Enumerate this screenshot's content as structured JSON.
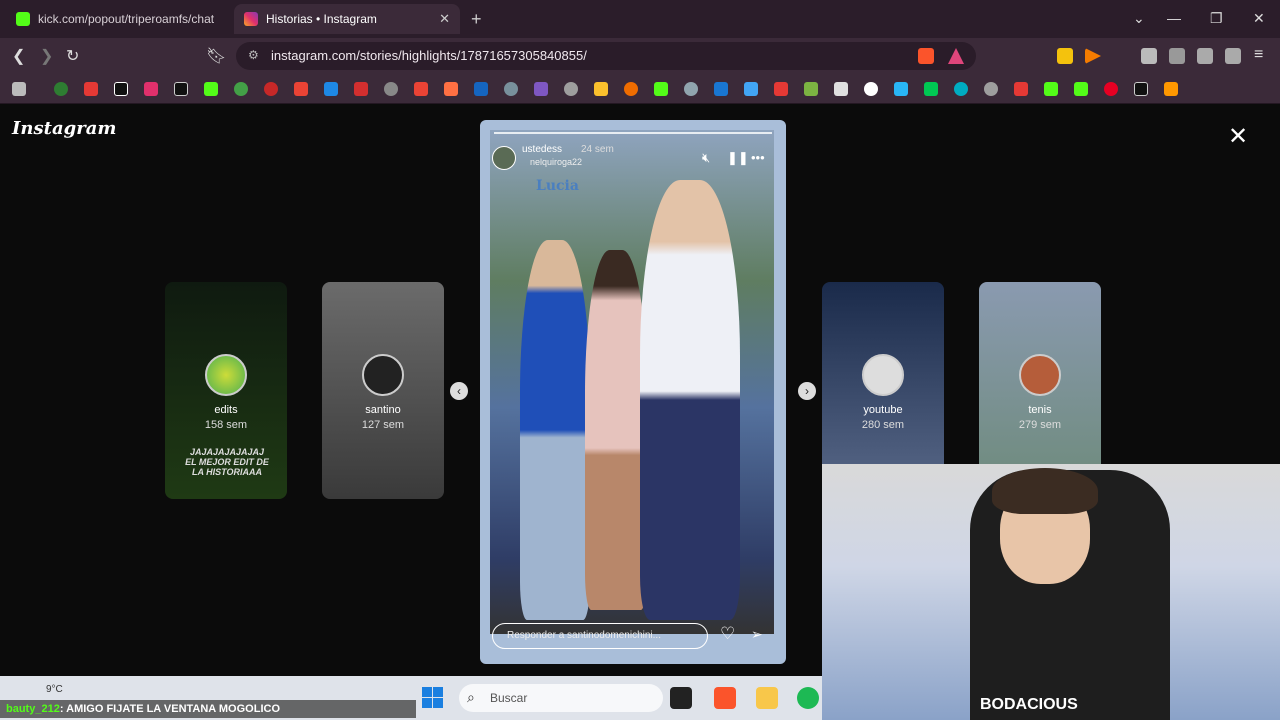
{
  "browser": {
    "tabs": [
      {
        "title": "kick.com/popout/triperoamfs/chat",
        "icon": "kick-icon",
        "color": "#53fc18"
      },
      {
        "title": "Historias • Instagram",
        "icon": "instagram-icon",
        "color": "#e1306c"
      }
    ],
    "url": "instagram.com/stories/highlights/17871657305840855/"
  },
  "instagram": {
    "logo": "Instagram",
    "highlights_left": [
      {
        "name": "edits",
        "age": "158 sem",
        "caption": "JAJAJAJAJAJAJ EL MEJOR EDIT DE LA HISTORIAAA"
      },
      {
        "name": "santino",
        "age": "127 sem"
      }
    ],
    "highlights_right": [
      {
        "name": "youtube",
        "age": "280 sem"
      },
      {
        "name": "tenis",
        "age": "279 sem"
      }
    ],
    "story": {
      "username": "ustedess",
      "time": "24 sem",
      "subline": "nelquiroga22",
      "sticker_text": "Lucia",
      "reply_placeholder": "Responder a santinodomenichini..."
    }
  },
  "taskbar": {
    "temperature": "9°C",
    "search_placeholder": "Buscar"
  },
  "chat_overlay": {
    "user": "bauty_212",
    "message": ": AMIGO FIJATE LA VENTANA MOGOLICO"
  }
}
